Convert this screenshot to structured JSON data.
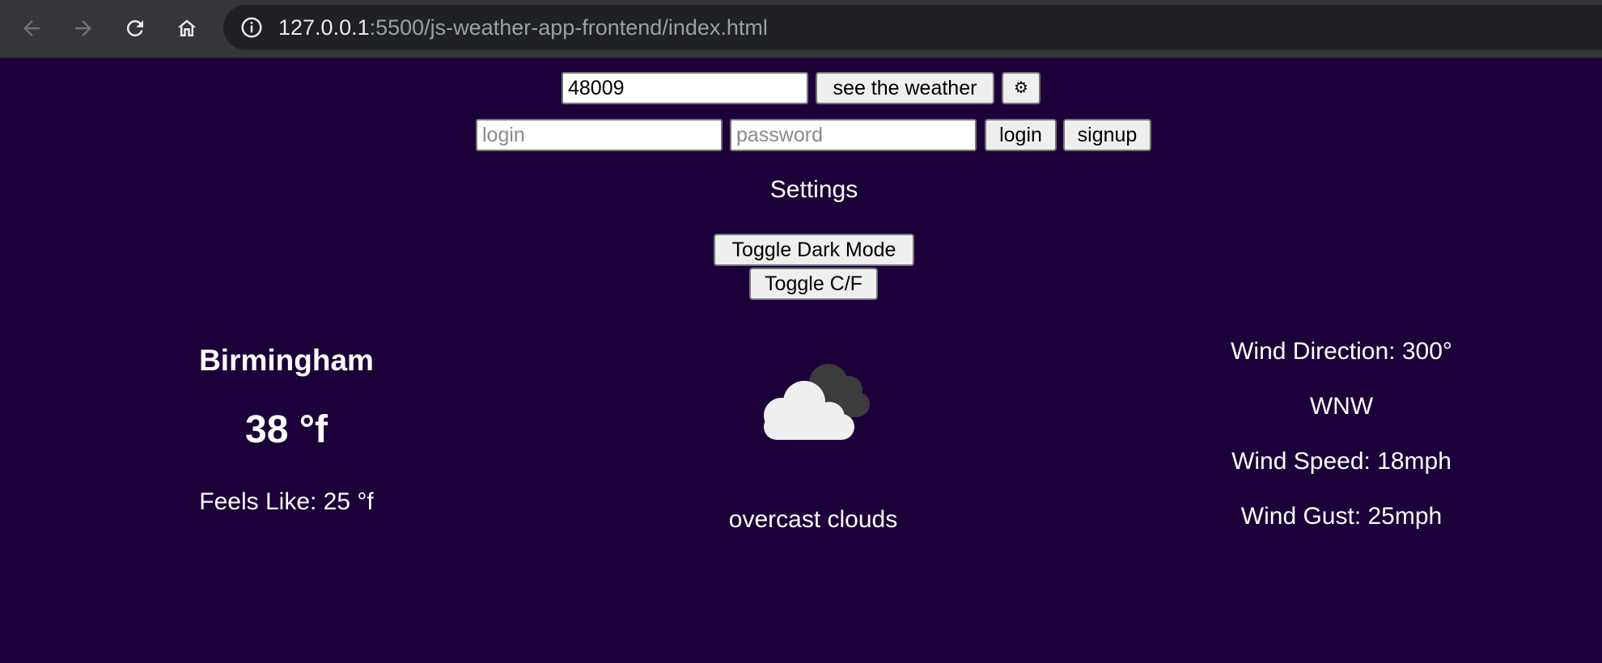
{
  "browser": {
    "url_host": "127.0.0.1",
    "url_rest": ":5500/js-weather-app-frontend/index.html"
  },
  "search": {
    "zip_value": "48009",
    "submit_label": "see the weather",
    "settings_icon_glyph": "⚙",
    "settings_icon": "gear-icon"
  },
  "auth": {
    "login_placeholder": "login",
    "password_placeholder": "password",
    "login_label": "login",
    "signup_label": "signup"
  },
  "settings": {
    "title": "Settings",
    "toggle_dark_label": "Toggle Dark Mode",
    "toggle_units_label": "Toggle C/F"
  },
  "weather": {
    "city": "Birmingham",
    "temperature": "38 °f",
    "feels_like": "Feels Like: 25 °f",
    "icon": "overcast-clouds-icon",
    "description": "overcast clouds"
  },
  "wind": {
    "direction": "Wind Direction: 300°",
    "cardinal": "WNW",
    "speed": "Wind Speed: 18mph",
    "gust": "Wind Gust: 25mph"
  },
  "colors": {
    "page_background": "#1c0039",
    "text": "#ffffff",
    "browser_bar": "#35363a",
    "omnibox": "#202124"
  }
}
